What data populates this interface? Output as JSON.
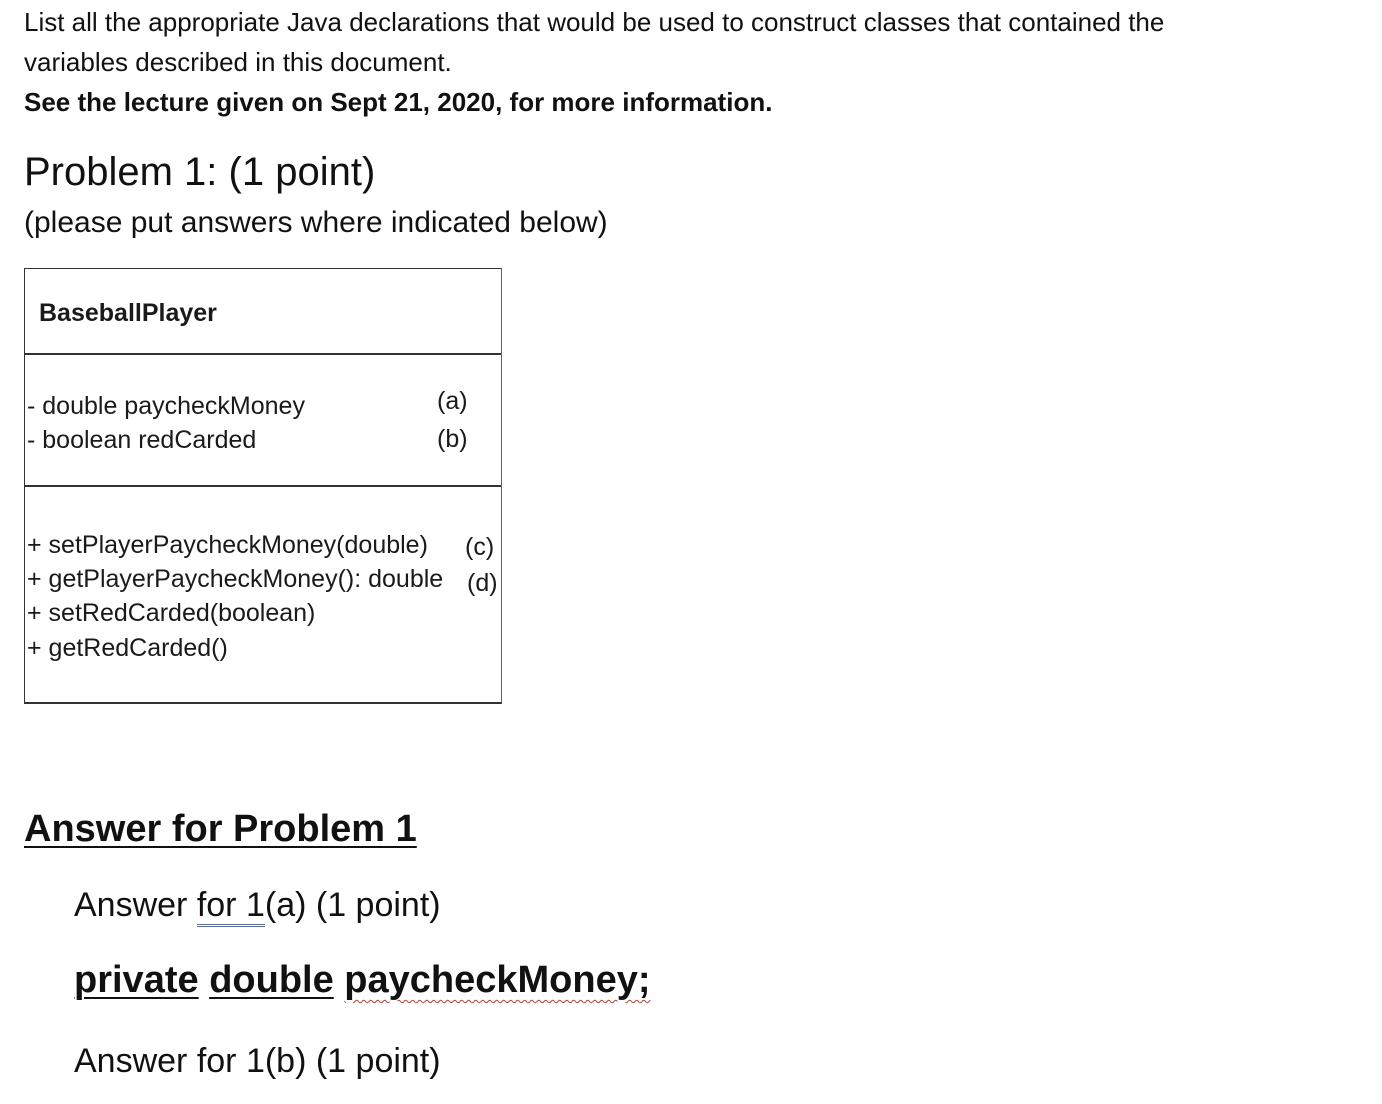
{
  "intro": {
    "line1": "List all the appropriate Java declarations that would be used to construct classes that contained the",
    "line2": "variables described in this document.",
    "line3": "See the lecture given on Sept 21, 2020, for more information."
  },
  "problem": {
    "title": "Problem 1: (1 point)",
    "subtitle": "(please put answers where indicated below)"
  },
  "uml": {
    "class_name": "BaseballPlayer",
    "attributes": [
      {
        "text": "- double paycheckMoney",
        "tag": "(a)"
      },
      {
        "text": "- boolean redCarded",
        "tag": "(b)"
      }
    ],
    "operations": [
      {
        "text": "+ setPlayerPaycheckMoney(double)",
        "tag": "(c)"
      },
      {
        "text": "+ getPlayerPaycheckMoney(): double",
        "tag": "(d)"
      },
      {
        "text": "+ setRedCarded(boolean)",
        "tag": ""
      },
      {
        "text": "+ getRedCarded()",
        "tag": ""
      }
    ]
  },
  "answer": {
    "heading": "Answer for Problem 1",
    "a_label_prefix": "Answer ",
    "a_label_link": "for  1",
    "a_label_suffix": "(a) (1 point)",
    "a_value_word1": "private",
    "a_value_word2": "double",
    "a_value_word3": "paycheckMoney;",
    "b_label": "Answer for 1(b) (1 point)"
  }
}
